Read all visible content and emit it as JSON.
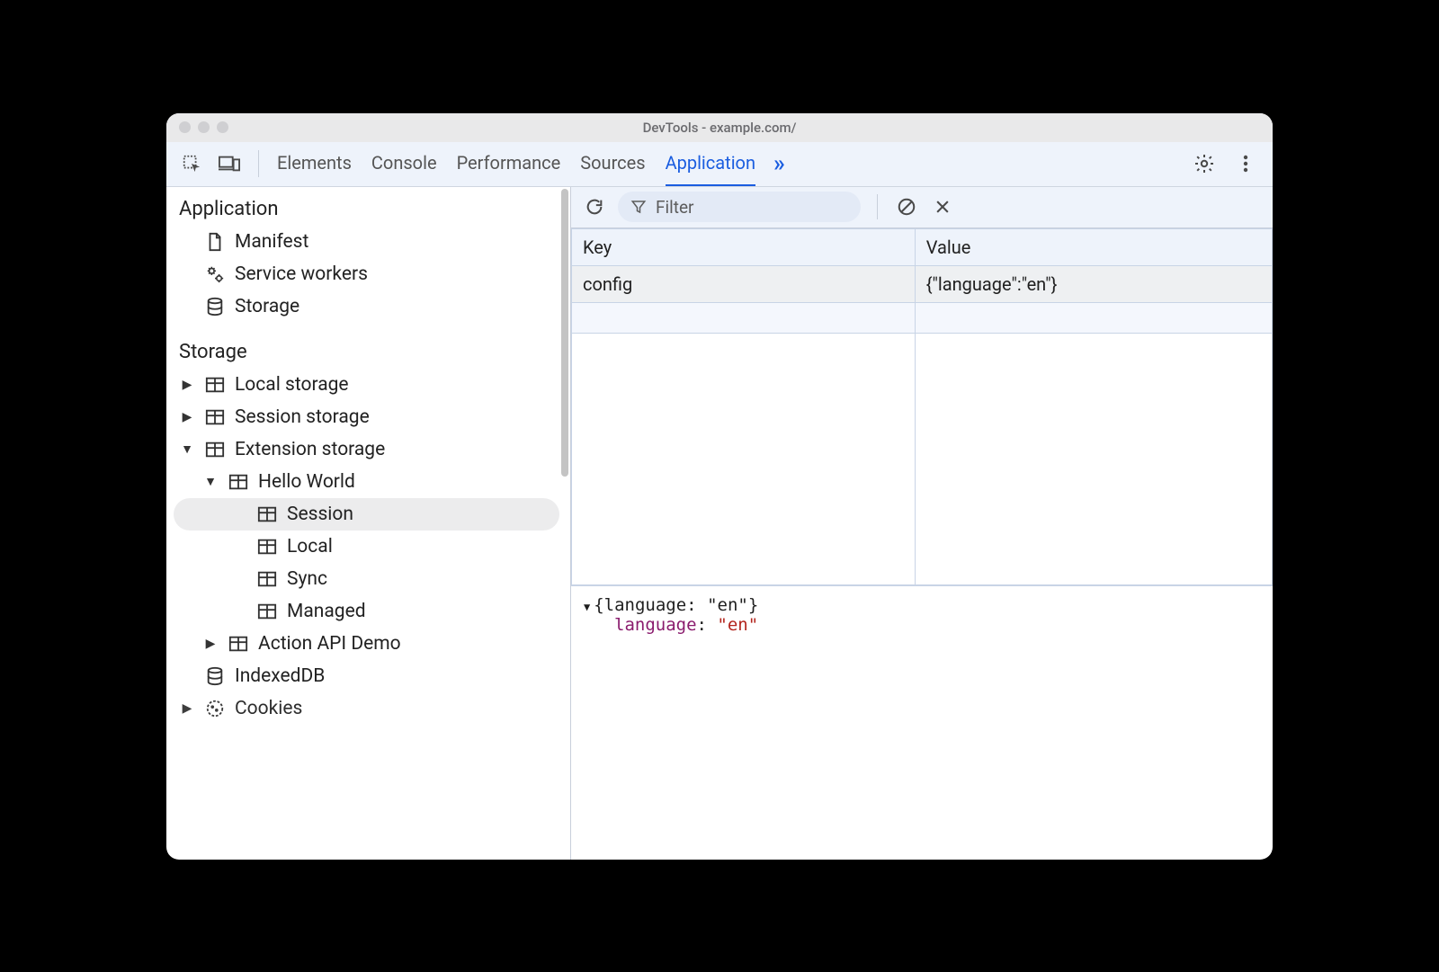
{
  "window_title": "DevTools - example.com/",
  "tabs": {
    "elements": "Elements",
    "console": "Console",
    "performance": "Performance",
    "sources": "Sources",
    "application": "Application"
  },
  "sidebar": {
    "section_application": "Application",
    "manifest": "Manifest",
    "service_workers": "Service workers",
    "storage_item": "Storage",
    "section_storage": "Storage",
    "local_storage": "Local storage",
    "session_storage": "Session storage",
    "extension_storage": "Extension storage",
    "hello_world": "Hello World",
    "session": "Session",
    "local": "Local",
    "sync": "Sync",
    "managed": "Managed",
    "action_api_demo": "Action API Demo",
    "indexeddb": "IndexedDB",
    "cookies": "Cookies"
  },
  "filter_placeholder": "Filter",
  "table": {
    "col_key": "Key",
    "col_value": "Value",
    "row_key": "config",
    "row_value": "{\"language\":\"en\"}"
  },
  "object_view": {
    "summary": "{language: \"en\"}",
    "prop_key": "language",
    "prop_colon": ": ",
    "prop_val": "\"en\""
  }
}
